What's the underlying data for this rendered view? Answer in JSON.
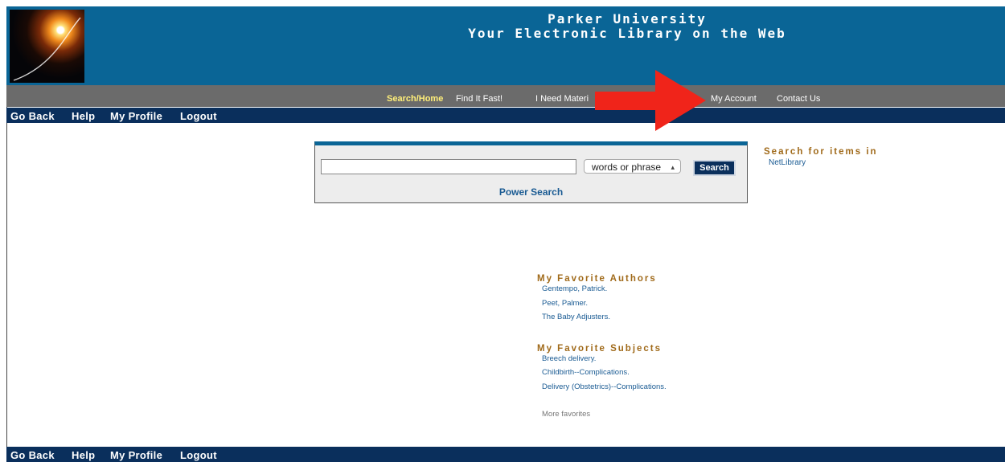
{
  "header": {
    "title_line1": "Parker University",
    "title_line2": "Your Electronic Library on the Web",
    "bg_color": "#0a6596"
  },
  "nav": {
    "items": [
      {
        "label": "Search/Home",
        "active": true
      },
      {
        "label": "Find It Fast!"
      },
      {
        "label": "I Need Materi"
      },
      {
        "label": "My Account"
      },
      {
        "label": "Contact Us"
      }
    ]
  },
  "toolbar": {
    "items": [
      "Go Back",
      "Help",
      "My Profile",
      "Logout"
    ]
  },
  "search": {
    "input_value": "",
    "type_selected": "words or phrase",
    "button_label": "Search",
    "power_search_label": "Power Search"
  },
  "search_for_items": {
    "title": "Search for items in",
    "link": "NetLibrary"
  },
  "favorites": {
    "authors_title": "My Favorite Authors",
    "authors": [
      "Gentempo, Patrick.",
      "Peet, Palmer.",
      "The Baby Adjusters."
    ],
    "subjects_title": "My Favorite Subjects",
    "subjects": [
      "Breech delivery.",
      "Childbirth--Complications.",
      "Delivery (Obstetrics)--Complications."
    ],
    "more_label": "More favorites"
  },
  "annotation": {
    "arrow_color": "#f0241a",
    "arrow_icon": "red-arrow-icon"
  }
}
